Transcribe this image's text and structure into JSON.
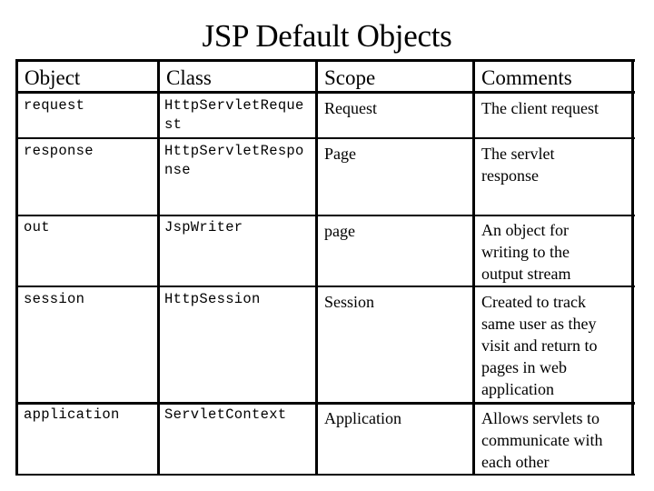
{
  "title": "JSP Default Objects",
  "table": {
    "headers": [
      "Object",
      "Class",
      "Scope",
      "Comments"
    ],
    "rows": [
      {
        "object": "request",
        "class": "HttpServletRequest",
        "scope": "Request",
        "comments": "The client request"
      },
      {
        "object": "response",
        "class": "HttpServletResponse",
        "scope": "Page",
        "comments": "The servlet response"
      },
      {
        "object": "out",
        "class": "JspWriter",
        "scope": "page",
        "comments": "An object for writing to the output stream"
      },
      {
        "object": "session",
        "class": "HttpSession",
        "scope": "Session",
        "comments": "Created to track same user as they visit and return to pages in web application"
      },
      {
        "object": "application",
        "class": "ServletContext",
        "scope": "Application",
        "comments": "Allows servlets to communicate with each other"
      }
    ]
  }
}
